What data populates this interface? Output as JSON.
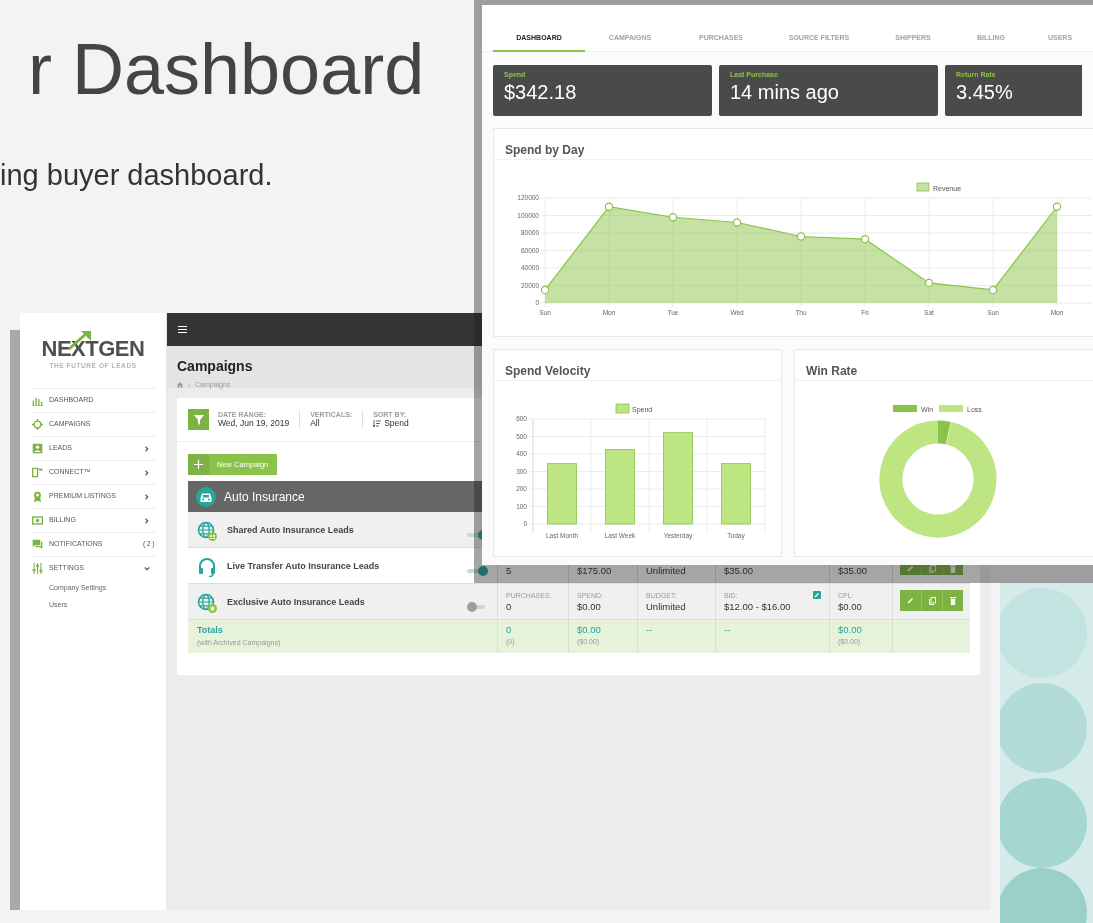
{
  "intro": {
    "heading": "r Dashboard",
    "subheading": "ing buyer dashboard."
  },
  "campaigns_app": {
    "logo": {
      "wordmark": "NEXTGEN",
      "tagline": "THE FUTURE OF LEADS"
    },
    "sidebar": {
      "items": [
        {
          "label": "DASHBOARD",
          "kind": "link"
        },
        {
          "label": "CAMPAIGNS",
          "kind": "link"
        },
        {
          "label": "LEADS",
          "kind": "menu",
          "expanded": false
        },
        {
          "label": "CONNECT™",
          "kind": "menu",
          "expanded": false
        },
        {
          "label": "PREMIUM LISTINGS",
          "kind": "menu",
          "expanded": false
        },
        {
          "label": "BILLING",
          "kind": "menu",
          "expanded": false
        },
        {
          "label": "NOTIFICATIONS",
          "kind": "count",
          "count": "(2)"
        },
        {
          "label": "SETTINGS",
          "kind": "menu",
          "expanded": true,
          "children": [
            {
              "label": "Company Settings"
            },
            {
              "label": "Users"
            }
          ]
        }
      ]
    },
    "title": "Campaigns",
    "breadcrumb": "Campaigns",
    "filters": [
      {
        "label": "DATE RANGE:",
        "value": "Wed, Jun 19, 2019"
      },
      {
        "label": "VERTICALS:",
        "value": "All"
      },
      {
        "label": "SORT BY:",
        "value": "Spend",
        "kind": "sort"
      }
    ],
    "new_campaign_button": "New Campaign",
    "group": {
      "title": "Auto Insurance",
      "campaigns": [
        {
          "name": "Shared Auto Insurance Leads",
          "on": true
        },
        {
          "name": "Live Transfer Auto Insurance Leads",
          "on": true,
          "stats": [
            {
              "value": "5"
            },
            {
              "value": "$175.00"
            },
            {
              "value": "Unlimited"
            },
            {
              "value": "$35.00"
            },
            {
              "value": "$35.00"
            }
          ]
        },
        {
          "name": "Exclusive Auto Insurance Leads",
          "on": false,
          "stats": [
            {
              "label": "PURCHASES:",
              "value": "0"
            },
            {
              "label": "SPEND:",
              "value": "$0.00"
            },
            {
              "label": "BUDGET:",
              "value": "Unlimited"
            },
            {
              "label": "BID:",
              "value": "$12.00 - $16.00",
              "kind": "bid"
            },
            {
              "label": "CPL:",
              "value": "$0.00"
            }
          ]
        }
      ]
    },
    "totals": {
      "label": "Totals",
      "note": "(with Archived Campaigns)",
      "cells": [
        {
          "value": "0",
          "sub": "(0)"
        },
        {
          "value": "$0.00",
          "sub": "($0.00)"
        },
        {
          "value": "--"
        },
        {
          "value": "--"
        },
        {
          "value": "$0.00",
          "sub": "($0.00)"
        }
      ]
    }
  },
  "dashboard_app": {
    "tabs": [
      {
        "label": "DASHBOARD",
        "selected": true
      },
      {
        "label": "CAMPAIGNS",
        "selected": false
      },
      {
        "label": "PURCHASES",
        "selected": false
      },
      {
        "label": "SOURCE FILTERS",
        "selected": false
      },
      {
        "label": "SHIPPERS",
        "selected": false
      },
      {
        "label": "BILLING",
        "selected": false
      },
      {
        "label": "USERS",
        "selected": false
      }
    ],
    "stats": [
      {
        "label": "Spend",
        "value": "$342.18"
      },
      {
        "label": "Last Purchase",
        "value": "14 mins ago"
      },
      {
        "label": "Return Rate",
        "value": "3.45%"
      }
    ],
    "spend_by_day": {
      "chart_data": {
        "type": "area",
        "title": "Spend by Day",
        "categories": [
          "Sun",
          "Mon",
          "Tue",
          "Wed",
          "Thu",
          "Fri",
          "Sat",
          "Sun",
          "Mon"
        ],
        "series": [
          {
            "name": "Revenue",
            "color": "#8bc34a",
            "values": [
              15000,
              110000,
              98000,
              92000,
              76000,
              73000,
              23000,
              15000,
              110000
            ]
          }
        ],
        "ylim": [
          0,
          120000
        ],
        "yticks": [
          0,
          20000,
          40000,
          60000,
          80000,
          100000,
          120000
        ],
        "grid": true
      }
    },
    "spend_velocity": {
      "chart_data": {
        "type": "bar",
        "title": "Spend Velocity",
        "categories": [
          "Last Month",
          "Last Week",
          "Yesterday",
          "Today"
        ],
        "series": [
          {
            "name": "Spend",
            "color": "#bde581",
            "values": [
              345,
              425,
              522,
              345
            ]
          }
        ],
        "ylim": [
          0,
          600
        ],
        "yticks": [
          0,
          100,
          200,
          300,
          400,
          500,
          600
        ],
        "grid": true
      }
    },
    "win_rate": {
      "title": "Win Rate",
      "legend": [
        {
          "label": "Win",
          "color": "#8bc34a"
        },
        {
          "label": "Loss",
          "color": "#bde581"
        }
      ]
    }
  }
}
